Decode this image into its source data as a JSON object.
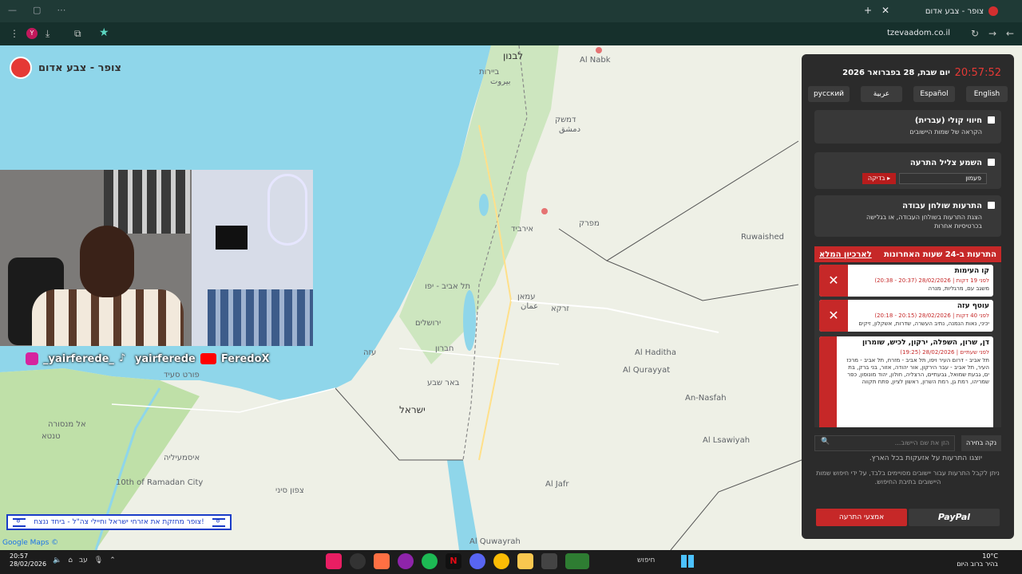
{
  "browser": {
    "tab_title": "צופר - צבע אדום",
    "url": "tzevaadom.co.il",
    "profile_initial": "Y"
  },
  "map": {
    "labels": {
      "lebanon": "לבנון",
      "beirut_he": "ביירות",
      "beirut_ar": "بيروت",
      "damascus_he": "דמשק",
      "damascus_ar": "دمشق",
      "tel_aviv": "תל אביב - יפו",
      "jerusalem": "ירושלים",
      "amman_he": "עמאן",
      "amman_ar": "عمان",
      "israel": "ישראל",
      "beersheba": "באר שבע",
      "gaza": "עזה",
      "irbid": "אירביד",
      "zarqa": "זרקא",
      "hebron": "חברון",
      "port_said": "פורט סעיד",
      "ismailia": "איסמעיליה",
      "tenth_of_ramadan": "10th of Ramadan City",
      "sinai": "צפון סיני",
      "mafraq": "מפרק",
      "al_hadithah": "Al Haditha",
      "al_qurayyat": "Al Qurayyat",
      "an_nasfah": "An-Nasfah",
      "al_lsawiyah": "Al Lsawiyah",
      "al_jafr": "Al Jafr",
      "al_quwayrah": "Al Quwayrah",
      "al_nabk": "Al Nabk",
      "rukban": "Ruwaished",
      "tanta": "טנטא",
      "mansoura": "אל מנסורה"
    },
    "credit": "Google Maps ©"
  },
  "overlay": {
    "brand_title": "צופר - צבע אדום",
    "socials": [
      "_yairferede_",
      "yairferede",
      "FeredoX"
    ],
    "banner_text": "צופר מחזקת את אזרחי ישראל וחיילי צה\"ל - ביחד ננצח!"
  },
  "panel": {
    "time": "20:57:52",
    "date": "יום שבת, 28 בפברואר 2026",
    "languages": [
      "русский",
      "عربية",
      "Español",
      "English"
    ],
    "voice": {
      "title": "חיווי קולי (עברית)",
      "sub": "הקראה של שמות היישובים"
    },
    "sound": {
      "title": "השמע צליל התרעה",
      "select": "פעמון",
      "test": "▸ בדיקה"
    },
    "desktop": {
      "title": "התרעות שולחן עבודה",
      "sub": "הצגת התרעות בשולחן העבודה, או בגלישה בכרטיסיות אחרות"
    },
    "alerts_header": "התרעות ב-24 שעות האחרונות",
    "archive_link": "לארכיון המלא",
    "alerts": [
      {
        "area": "קו העימות",
        "time": "לפני 19 דקות | 28/02/2026 (20:37 - 20:38)",
        "cities": "משגב עם, מרגליות, מנרה"
      },
      {
        "area": "עוטף עזה",
        "time": "לפני 40 דקות | 28/02/2026 (20:15 - 20:18)",
        "cities": "יכיני, נאות הנמנה, נתיב העשרה, שדרות, אשקלון, זיקים"
      },
      {
        "area": "דן, שרון, השפלה, ירקון, לכיש, שומרון",
        "time": "לפני שעתיים | 28/02/2026 (19:25)",
        "cities": "תל אביב - דרום העיר ויפו, תל אביב - מזרח, תל אביב - מרכז העיר, תל אביב - עבר הירקון, אור יהודה, אזור, בני ברק, בת ים, גבעת שמואל, גבעתיים, הרצליה, חולון, יהוד מונוסון, כפר שמריהו, רמת גן, רמת השרון, ראשון לציון, פתח תקווה"
      }
    ],
    "search_placeholder": "הזן את שם היישוב...",
    "clear_btn": "נקה בחירה",
    "note1": "יוצגו התרעות על אזעקות בכל הארץ.",
    "note2": "ניתן לקבל התרעות עבור יישובים מסויימים בלבד, על ידי חיפוש שמות היישובים בתיבת החיפוש.",
    "options_btn": "אמצעי התרעה",
    "paypal_btn": "PayPal"
  },
  "taskbar": {
    "time": "20:57",
    "date": "28/02/2026",
    "lang": "עב",
    "search": "חיפוש",
    "weather_temp": "10°C",
    "weather_desc": "בהיר ברוב היום"
  }
}
